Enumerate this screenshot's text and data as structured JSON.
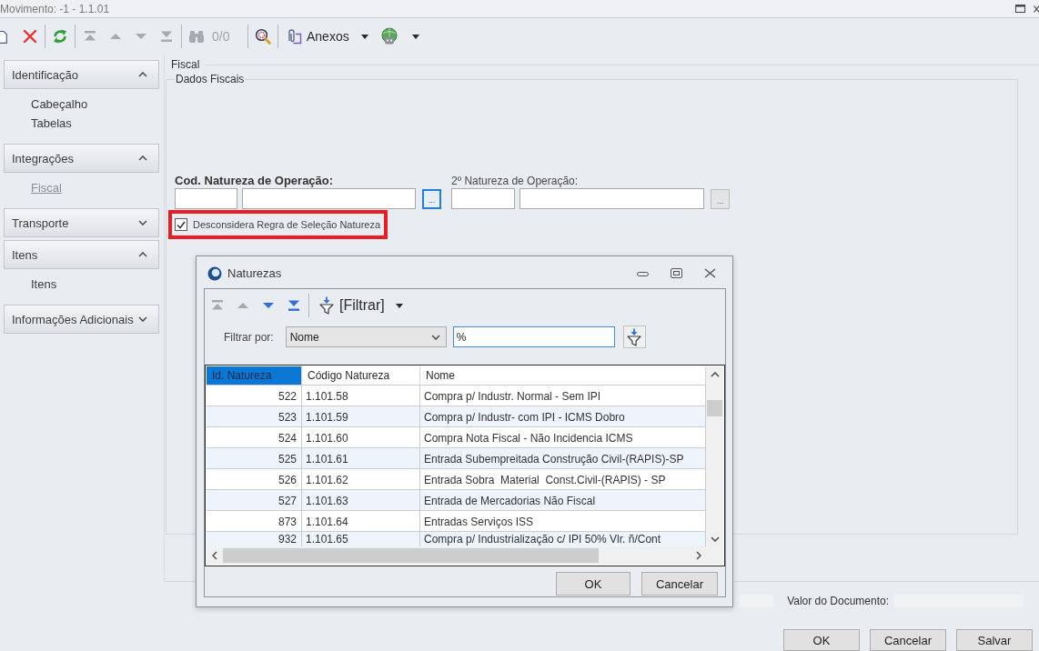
{
  "window": {
    "title": "Movimento: -1 - 1.1.01"
  },
  "toolbar": {
    "items": [
      {
        "kind": "new",
        "disabled": false
      },
      {
        "kind": "delete",
        "disabled": false
      },
      {
        "kind": "separator"
      },
      {
        "kind": "refresh",
        "disabled": false
      },
      {
        "kind": "separator"
      },
      {
        "kind": "first",
        "disabled": true
      },
      {
        "kind": "previous",
        "disabled": true
      },
      {
        "kind": "next",
        "disabled": true
      },
      {
        "kind": "last",
        "disabled": true
      },
      {
        "kind": "separator"
      },
      {
        "kind": "find",
        "disabled": true
      },
      {
        "kind": "counter",
        "label": "0/0",
        "disabled": true
      },
      {
        "kind": "separator"
      },
      {
        "kind": "query",
        "disabled": false
      },
      {
        "kind": "separator"
      },
      {
        "kind": "attachments",
        "label": "Anexos",
        "disabled": false
      },
      {
        "kind": "globe",
        "disabled": false
      }
    ]
  },
  "sidebar": {
    "groups": [
      {
        "title": "Identificação",
        "expanded": true,
        "items": [
          {
            "label": "Cabeçalho",
            "selected": false
          },
          {
            "label": "Tabelas",
            "selected": false
          }
        ]
      },
      {
        "title": "Integrações",
        "expanded": true,
        "items": [
          {
            "label": "Fiscal",
            "selected": true
          }
        ]
      },
      {
        "title": "Transporte",
        "expanded": false
      },
      {
        "title": "Itens",
        "expanded": true,
        "items": [
          {
            "label": "Itens",
            "selected": false
          }
        ]
      },
      {
        "title": "Informações Adicionais",
        "expanded": false
      }
    ]
  },
  "form": {
    "section_title": "Fiscal",
    "group_title": "Dados Fiscais",
    "natures": [
      {
        "kind": "primary",
        "label": "Cod. Natureza de Operação:",
        "lookup": {
          "label": "...",
          "focused": true
        }
      },
      {
        "kind": "secondary",
        "label": "2º Natureza de Operação:",
        "lookup": {
          "label": "...",
          "focused": false
        }
      }
    ],
    "ignore_rule": {
      "label": "Desconsidera Regra de Seleção Natureza",
      "checked": true,
      "highlighted": true
    }
  },
  "totals": {
    "label": "Valor do Documento:"
  },
  "buttons": [
    "OK",
    "Cancelar",
    "Salvar"
  ],
  "dialog": {
    "title": "Naturezas",
    "toolbar": {
      "items": [
        {
          "kind": "first",
          "disabled": true
        },
        {
          "kind": "previous",
          "disabled": true
        },
        {
          "kind": "next",
          "disabled": false
        },
        {
          "kind": "last",
          "disabled": false
        },
        {
          "kind": "separator"
        },
        {
          "kind": "filter",
          "label": "[Filtrar]"
        }
      ]
    },
    "filter": {
      "label": "Filtrar por:",
      "field": "Nome",
      "value": "%"
    },
    "table": {
      "columns": [
        {
          "label": "Id. Natureza",
          "selected": true
        },
        {
          "label": "Código Natureza",
          "selected": false
        },
        {
          "label": "Nome",
          "selected": false
        }
      ],
      "rows": [
        [
          "522",
          "1.101.58",
          "Compra p/ Industr. Normal - Sem IPI"
        ],
        [
          "523",
          "1.101.59",
          "Compra p/ Industr- com IPI - ICMS Dobro"
        ],
        [
          "524",
          "1.101.60",
          "Compra Nota Fiscal - Não Incidencia ICMS"
        ],
        [
          "525",
          "1.101.61",
          "Entrada Subempreitada Construção Civil-(RAPIS)-SP"
        ],
        [
          "526",
          "1.101.62",
          "Entrada Sobra  Material  Const.Civil-(RAPIS) - SP"
        ],
        [
          "527",
          "1.101.63",
          "Entrada de Mercadorias Não Fiscal"
        ],
        [
          "873",
          "1.101.64",
          "Entradas Serviços ISS"
        ],
        [
          "932",
          "1.101.65",
          "Compra p/ Industrialização c/ IPI 50% Vlr. ñ/Cont"
        ]
      ]
    },
    "buttons": [
      "OK",
      "Cancelar"
    ]
  }
}
